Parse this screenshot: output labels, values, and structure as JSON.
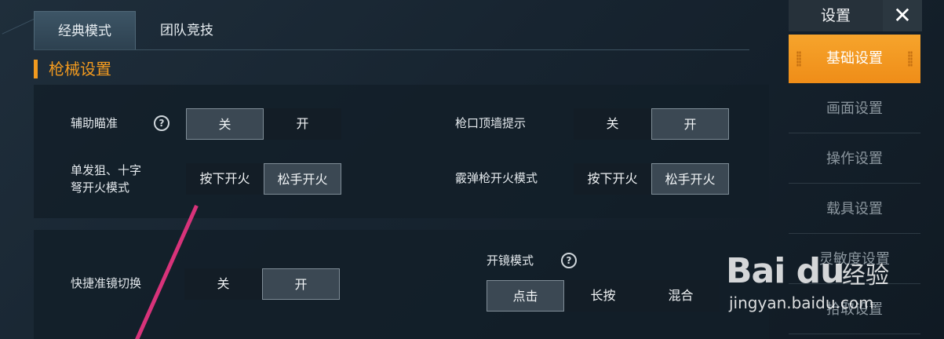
{
  "tabs": [
    "经典模式",
    "团队竞技"
  ],
  "section_title": "枪械设置",
  "panel1": {
    "aim_assist": {
      "label": "辅助瞄准",
      "options": [
        "关",
        "开"
      ],
      "selected": "关"
    },
    "muzzle_hint": {
      "label": "枪口顶墙提示",
      "options": [
        "关",
        "开"
      ],
      "selected": "开"
    },
    "sniper_fire": {
      "label_line1": "单发狙、十字",
      "label_line2": "弩开火模式",
      "options": [
        "按下开火",
        "松手开火"
      ],
      "selected": "松手开火"
    },
    "shotgun_fire": {
      "label": "霰弹枪开火模式",
      "options": [
        "按下开火",
        "松手开火"
      ],
      "selected": "松手开火"
    }
  },
  "panel2": {
    "scope_switch": {
      "label": "快捷准镜切换",
      "options": [
        "关",
        "开"
      ],
      "selected": "开"
    },
    "scope_mode": {
      "label": "开镜模式",
      "options": [
        "点击",
        "长按",
        "混合"
      ],
      "selected": "点击"
    }
  },
  "help_glyph": "?",
  "sidebar": {
    "title": "设置",
    "close_glyph": "✕",
    "items": [
      "基础设置",
      "画面设置",
      "操作设置",
      "载具设置",
      "灵敏度设置",
      "拾取设置"
    ],
    "active": "基础设置"
  },
  "watermark": {
    "logo": "Bai du",
    "text": "经验",
    "url": "jingyan.baidu.com"
  },
  "colors": {
    "accent": "#f29a1f",
    "annotation_line": "#d8337a"
  }
}
